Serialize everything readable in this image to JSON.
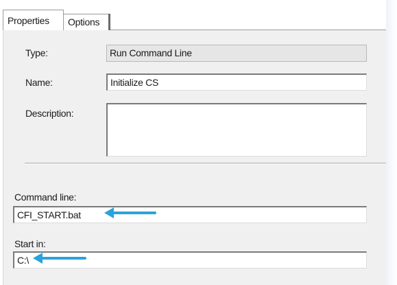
{
  "tabs": [
    {
      "label": "Properties",
      "active": true
    },
    {
      "label": "Options",
      "active": false
    }
  ],
  "form": {
    "type": {
      "label": "Type:",
      "value": "Run Command Line"
    },
    "name": {
      "label": "Name:",
      "value": "Initialize CS"
    },
    "description": {
      "label": "Description:",
      "value": ""
    },
    "command_line": {
      "label": "Command line:",
      "value": "CFI_START.bat"
    },
    "start_in": {
      "label": "Start in:",
      "value": "C:\\"
    }
  },
  "annotations": {
    "arrow_color": "#29a3dc"
  }
}
